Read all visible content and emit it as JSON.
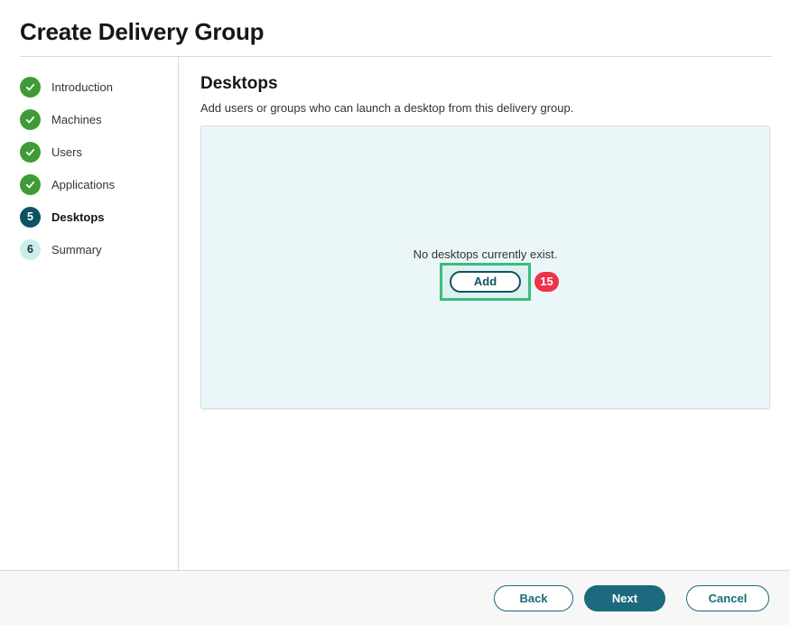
{
  "page": {
    "title": "Create Delivery Group"
  },
  "sidebar": {
    "steps": [
      {
        "label": "Introduction",
        "status": "complete"
      },
      {
        "label": "Machines",
        "status": "complete"
      },
      {
        "label": "Users",
        "status": "complete"
      },
      {
        "label": "Applications",
        "status": "complete"
      },
      {
        "label": "Desktops",
        "status": "current",
        "number": "5"
      },
      {
        "label": "Summary",
        "status": "upcoming",
        "number": "6"
      }
    ]
  },
  "main": {
    "heading": "Desktops",
    "description": "Add users or groups who can launch a desktop from this delivery group.",
    "empty_state": {
      "message": "No desktops currently exist.",
      "add_button_label": "Add"
    },
    "annotation": {
      "badge": "15"
    }
  },
  "footer": {
    "back_label": "Back",
    "next_label": "Next",
    "cancel_label": "Cancel"
  },
  "colors": {
    "step_complete": "#3e9b35",
    "step_current": "#0e5364",
    "step_upcoming_bg": "#cbeee8",
    "accent_teal": "#1b6a7d",
    "panel_bg": "#ebf6f8",
    "annotation_green": "#3abd7a",
    "annotation_red": "#ee3248"
  }
}
